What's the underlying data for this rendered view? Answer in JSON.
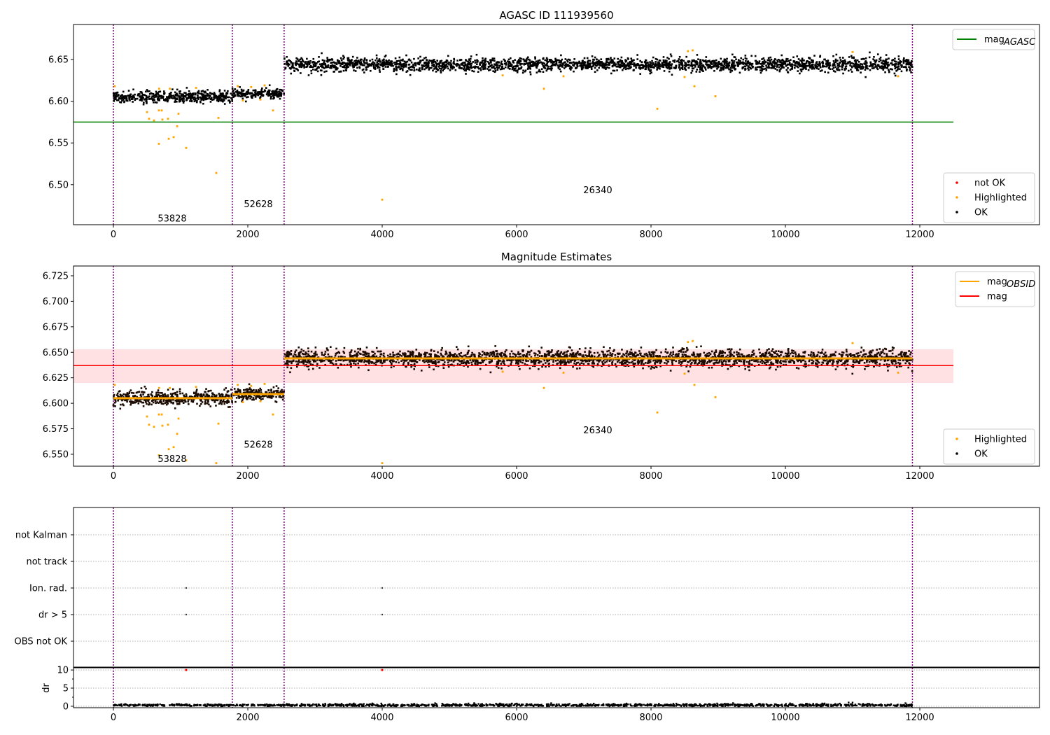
{
  "chart_data": [
    {
      "id": "p1",
      "type": "scatter",
      "title": "AGASC ID 111939560",
      "xlim": [
        -594,
        13781
      ],
      "ylim": [
        6.452,
        6.692
      ],
      "xticks": [
        0,
        2000,
        4000,
        6000,
        8000,
        10000,
        12000
      ],
      "yticks": [
        6.5,
        6.55,
        6.6,
        6.65
      ],
      "ytick_labels": [
        "6.50",
        "6.55",
        "6.60",
        "6.65"
      ],
      "obs_boundaries": [
        0,
        1770,
        2540,
        11890
      ],
      "segments": [
        {
          "x": [
            0,
            1770
          ],
          "mean": 6.605,
          "sd": 0.0035
        },
        {
          "x": [
            1770,
            2540
          ],
          "mean": 6.609,
          "sd": 0.003
        },
        {
          "x": [
            2540,
            11890
          ],
          "mean": 6.644,
          "sd": 0.0042
        }
      ],
      "segment_labels": [
        {
          "text": "53828",
          "x": 875,
          "y": 6.46
        },
        {
          "text": "52628",
          "x": 2156,
          "y": 6.477
        },
        {
          "text": "26340",
          "x": 7208,
          "y": 6.494
        }
      ],
      "hlines": [
        {
          "name": "mag_AGASC",
          "value": 6.575,
          "color": "#008000",
          "x": [
            -594,
            12500
          ]
        }
      ],
      "highlighted": [
        [
          500,
          6.587
        ],
        [
          531,
          6.579
        ],
        [
          604,
          6.577
        ],
        [
          677,
          6.589
        ],
        [
          719,
          6.589
        ],
        [
          677,
          6.549
        ],
        [
          729,
          6.578
        ],
        [
          812,
          6.579
        ],
        [
          823,
          6.555
        ],
        [
          896,
          6.557
        ],
        [
          948,
          6.57
        ],
        [
          969,
          6.585
        ],
        [
          1083,
          6.544
        ],
        [
          1531,
          6.514
        ],
        [
          1563,
          6.58
        ],
        [
          1927,
          6.601
        ],
        [
          2188,
          6.602
        ],
        [
          2375,
          6.589
        ],
        [
          4000,
          6.482
        ],
        [
          5792,
          6.631
        ],
        [
          6406,
          6.615
        ],
        [
          6698,
          6.63
        ],
        [
          8094,
          6.591
        ],
        [
          8500,
          6.629
        ],
        [
          8646,
          6.618
        ],
        [
          8958,
          6.606
        ],
        [
          11677,
          6.63
        ],
        [
          20,
          6.618
        ],
        [
          680,
          6.615
        ],
        [
          840,
          6.615
        ],
        [
          1230,
          6.616
        ],
        [
          1850,
          6.618
        ],
        [
          2050,
          6.617
        ],
        [
          2250,
          6.619
        ],
        [
          11000,
          6.659
        ],
        [
          8550,
          6.66
        ],
        [
          8620,
          6.661
        ]
      ],
      "legend_top": {
        "placement": "top-right",
        "entries": [
          {
            "label": "mag",
            "sub": "AGASC",
            "color": "#008000"
          }
        ]
      },
      "legend_bottom": {
        "placement": "lower-right",
        "entries": [
          {
            "label": "not OK",
            "color": "#ff0000"
          },
          {
            "label": "Highlighted",
            "color": "#ffa500"
          },
          {
            "label": "OK",
            "color": "#000000"
          }
        ]
      }
    },
    {
      "id": "p2",
      "type": "scatter",
      "title": "Magnitude Estimates",
      "xlim": [
        -594,
        13781
      ],
      "ylim": [
        6.5383,
        6.7346
      ],
      "xticks": [
        0,
        2000,
        4000,
        6000,
        8000,
        10000,
        12000
      ],
      "yticks": [
        6.55,
        6.575,
        6.6,
        6.625,
        6.65,
        6.675,
        6.7,
        6.725
      ],
      "ytick_labels": [
        "6.550",
        "6.575",
        "6.600",
        "6.625",
        "6.650",
        "6.675",
        "6.700",
        "6.725"
      ],
      "obs_boundaries": [
        0,
        1770,
        2540,
        11890
      ],
      "segment_labels": [
        {
          "text": "53828",
          "x": 875,
          "y": 6.546
        },
        {
          "text": "52628",
          "x": 2156,
          "y": 6.56
        },
        {
          "text": "26340",
          "x": 7208,
          "y": 6.574
        }
      ],
      "mag_obsid": [
        {
          "x": [
            0,
            1770
          ],
          "value": 6.605
        },
        {
          "x": [
            1770,
            2540
          ],
          "value": 6.609
        },
        {
          "x": [
            2540,
            11890
          ],
          "value": 6.644
        }
      ],
      "mag": {
        "value": 6.637,
        "band": [
          6.62,
          6.653
        ],
        "x": [
          -594,
          12500
        ],
        "color": "#ff0000",
        "band_color": "#ffe0e3"
      },
      "legend_top": {
        "placement": "top-right",
        "entries": [
          {
            "label": "mag",
            "sub": "OBSID",
            "color": "#ffa500"
          },
          {
            "label": "mag",
            "sub": "",
            "color": "#ff0000"
          }
        ]
      },
      "legend_bottom": {
        "placement": "lower-right",
        "entries": [
          {
            "label": "Highlighted",
            "color": "#ffa500"
          },
          {
            "label": "OK",
            "color": "#000000"
          }
        ]
      }
    },
    {
      "id": "p3",
      "type": "scatter",
      "title": "",
      "categories": [
        "OBS not OK",
        "dr > 5",
        "Ion. rad.",
        "not track",
        "not Kalman"
      ],
      "flags": [
        {
          "category": "Ion. rad.",
          "x": [
            1083,
            4000
          ]
        },
        {
          "category": "dr > 5",
          "x": [
            1083,
            4000
          ]
        }
      ],
      "obs_boundaries": [
        0,
        1770,
        2540,
        11890
      ]
    },
    {
      "id": "p4",
      "type": "scatter",
      "ylabel": "dr",
      "xlim": [
        -594,
        13781
      ],
      "ylim": [
        -0.4,
        10.6
      ],
      "yticks": [
        0,
        5,
        10
      ],
      "ytick_labels": [
        "0",
        "5",
        "10"
      ],
      "xticks": [
        0,
        2000,
        4000,
        6000,
        8000,
        10000,
        12000
      ],
      "obs_boundaries": [
        0,
        1770,
        2540,
        11890
      ],
      "dr_mean": 0.3,
      "not_ok_points": [
        [
          1083,
          10
        ],
        [
          4000,
          10
        ]
      ]
    }
  ]
}
